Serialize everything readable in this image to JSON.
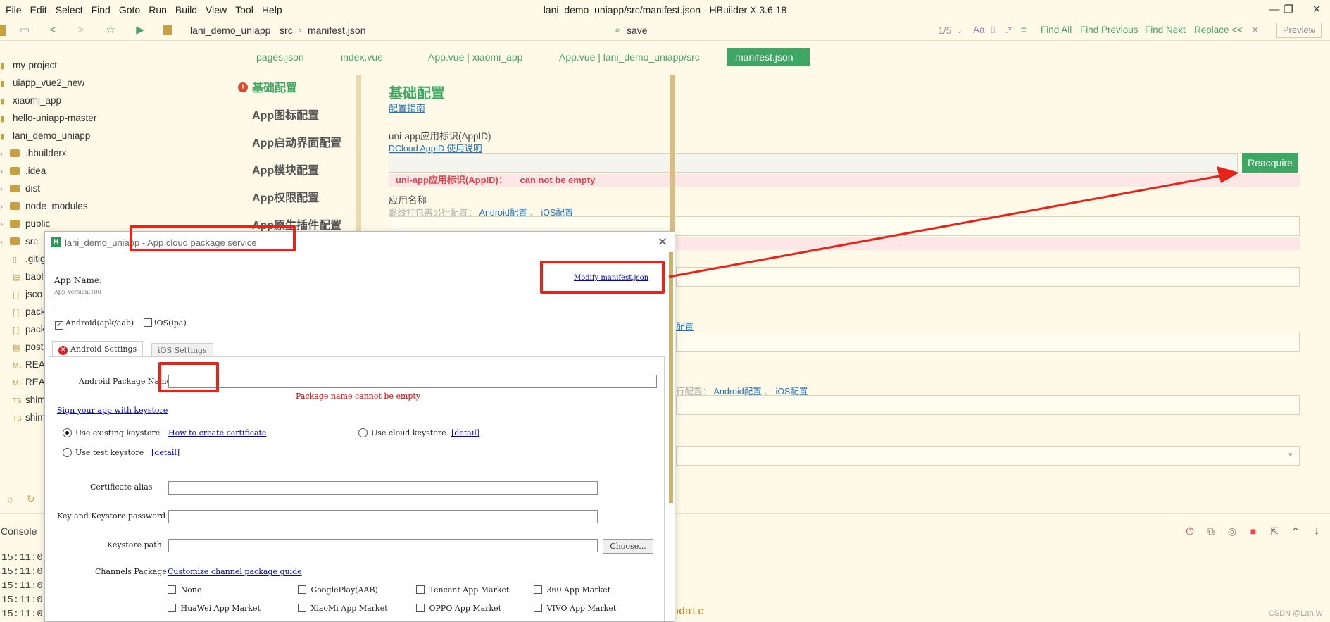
{
  "menu": [
    "File",
    "Edit",
    "Select",
    "Find",
    "Goto",
    "Run",
    "Build",
    "View",
    "Tool",
    "Help"
  ],
  "window_title": "lani_demo_uniapp/src/manifest.json - HBuilder X 3.6.18",
  "breadcrumb": [
    "lani_demo_uniapp",
    "src",
    "manifest.json"
  ],
  "find": {
    "value": "save",
    "count": "1/5",
    "find_all": "Find All",
    "find_previous": "Find Previous",
    "find_next": "Find Next",
    "replace": "Replace <<",
    "preview": "Preview"
  },
  "sidebar": {
    "items": [
      {
        "label": "my-project",
        "type": "project"
      },
      {
        "label": "uiapp_vue2_new",
        "type": "project"
      },
      {
        "label": "xiaomi_app",
        "type": "project"
      },
      {
        "label": "hello-uniapp-master",
        "type": "project"
      },
      {
        "label": "lani_demo_uniapp",
        "type": "project"
      },
      {
        "label": ".hbuilderx",
        "type": "folder"
      },
      {
        "label": ".idea",
        "type": "folder"
      },
      {
        "label": "dist",
        "type": "folder"
      },
      {
        "label": "node_modules",
        "type": "folder"
      },
      {
        "label": "public",
        "type": "folder"
      },
      {
        "label": "src",
        "type": "folder"
      },
      {
        "label": ".gitig",
        "type": "file"
      },
      {
        "label": "babl",
        "type": "file"
      },
      {
        "label": "jsco",
        "type": "file"
      },
      {
        "label": "pack",
        "type": "file"
      },
      {
        "label": "pack",
        "type": "file"
      },
      {
        "label": "post",
        "type": "file"
      },
      {
        "label": "REA",
        "type": "md"
      },
      {
        "label": "REA",
        "type": "md"
      },
      {
        "label": "shim",
        "type": "ts"
      },
      {
        "label": "shim",
        "type": "ts"
      }
    ]
  },
  "tabs": [
    "pages.json",
    "index.vue",
    "App.vue | xiaomi_app",
    "App.vue | lani_demo_uniapp/src",
    "manifest.json"
  ],
  "config_nav": [
    "基础配置",
    "App图标配置",
    "App启动界面配置",
    "App模块配置",
    "App权限配置",
    "App原生插件配置"
  ],
  "form": {
    "title": "基础配置",
    "guide_link": "配置指南",
    "appid_label": "uni-app应用标识(AppID)",
    "appid_link": "DCloud AppID 使用说明",
    "reacquire": "Reacquire",
    "appid_error_label": "uni-app应用标识(AppID)：",
    "appid_error": "can not be empty",
    "name_label": "应用名称",
    "offline_hint": "离线打包需另行配置：",
    "android_cfg": "Android配置",
    "ios_cfg": "iOS配置",
    "partial_cfg": "配置",
    "partial_hint": "行配置："
  },
  "console": {
    "label": "Console",
    "lines": [
      "15:11:0",
      "15:11:0",
      "15:11:0",
      "15:11:0",
      "15:11:0"
    ],
    "partial_text": "pdate"
  },
  "dialog": {
    "title": "lani_demo_uniapp - App cloud package service",
    "app_name": "App Name:",
    "app_version": "App Version:100",
    "modify_link": "Modify manifest.json",
    "android_check": "Android(apk/aab)",
    "ios_check": "iOS(ipa)",
    "tab_android": "Android Settings",
    "tab_ios": "iOS Settings",
    "pkg_label": "Android Package Name",
    "pkg_error": "Package name cannot be empty",
    "sign_link": "Sign your app with keystore",
    "use_existing": "Use existing keystore",
    "how_to_link": "How to create certificate",
    "use_cloud": "Use cloud keystore",
    "detail": "[detail]",
    "use_test": "Use test keystore",
    "cert_alias": "Certificate alias",
    "key_password": "Key and Keystore password",
    "keystore_path": "Keystore path",
    "choose": "Choose...",
    "channels_label": "Channels Package",
    "channels_link": "Customize channel package guide",
    "channels": [
      "None",
      "GooglePlay(AAB)",
      "Tencent App Market",
      "360 App Market",
      "HuaWei App Market",
      "XiaoMi App Market",
      "OPPO App Market",
      "VIVO App Market"
    ]
  },
  "watermark": "CSDN @Lan.W",
  "colors": {
    "accent": "#3ea763",
    "error": "#e0434a",
    "annotation": "#e8231a",
    "link": "#1e73be"
  }
}
